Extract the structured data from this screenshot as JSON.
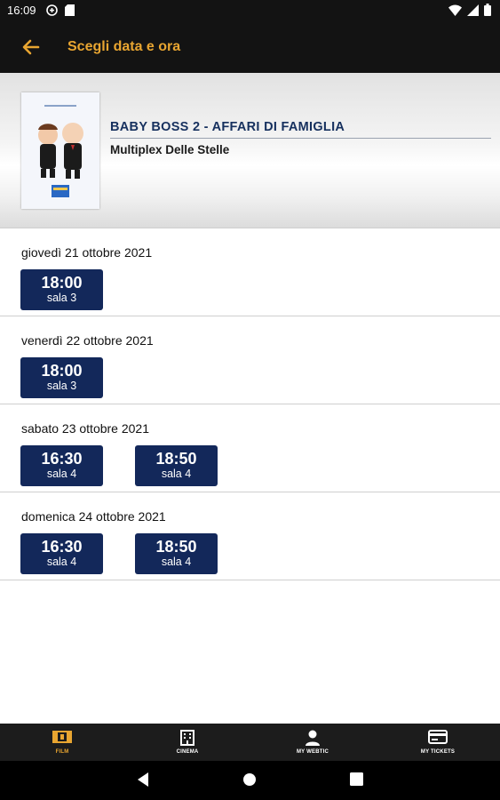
{
  "status_bar": {
    "time": "16:09"
  },
  "app_bar": {
    "title": "Scegli data e ora",
    "back_icon": "arrow-left-icon"
  },
  "movie": {
    "title": "BABY BOSS 2 - AFFARI DI FAMIGLIA",
    "cinema": "Multiplex Delle Stelle"
  },
  "days": [
    {
      "label": "giovedì 21 ottobre 2021",
      "slots": [
        {
          "time": "18:00",
          "room": "sala 3"
        }
      ]
    },
    {
      "label": "venerdì 22 ottobre 2021",
      "slots": [
        {
          "time": "18:00",
          "room": "sala 3"
        }
      ]
    },
    {
      "label": "sabato 23 ottobre 2021",
      "slots": [
        {
          "time": "16:30",
          "room": "sala 4"
        },
        {
          "time": "18:50",
          "room": "sala 4"
        }
      ]
    },
    {
      "label": "domenica 24 ottobre 2021",
      "slots": [
        {
          "time": "16:30",
          "room": "sala 4"
        },
        {
          "time": "18:50",
          "room": "sala 4"
        }
      ]
    }
  ],
  "tabs": [
    {
      "label": "FILM",
      "icon": "film-icon",
      "active": true
    },
    {
      "label": "CINEMA",
      "icon": "building-icon",
      "active": false
    },
    {
      "label": "MY WEBTIC",
      "icon": "user-icon",
      "active": false
    },
    {
      "label": "MY TICKETS",
      "icon": "ticket-icon",
      "active": false
    }
  ],
  "colors": {
    "accent": "#e8a531",
    "slot_bg": "#13285a",
    "title_blue": "#16305e",
    "bar_bg": "#131313"
  }
}
